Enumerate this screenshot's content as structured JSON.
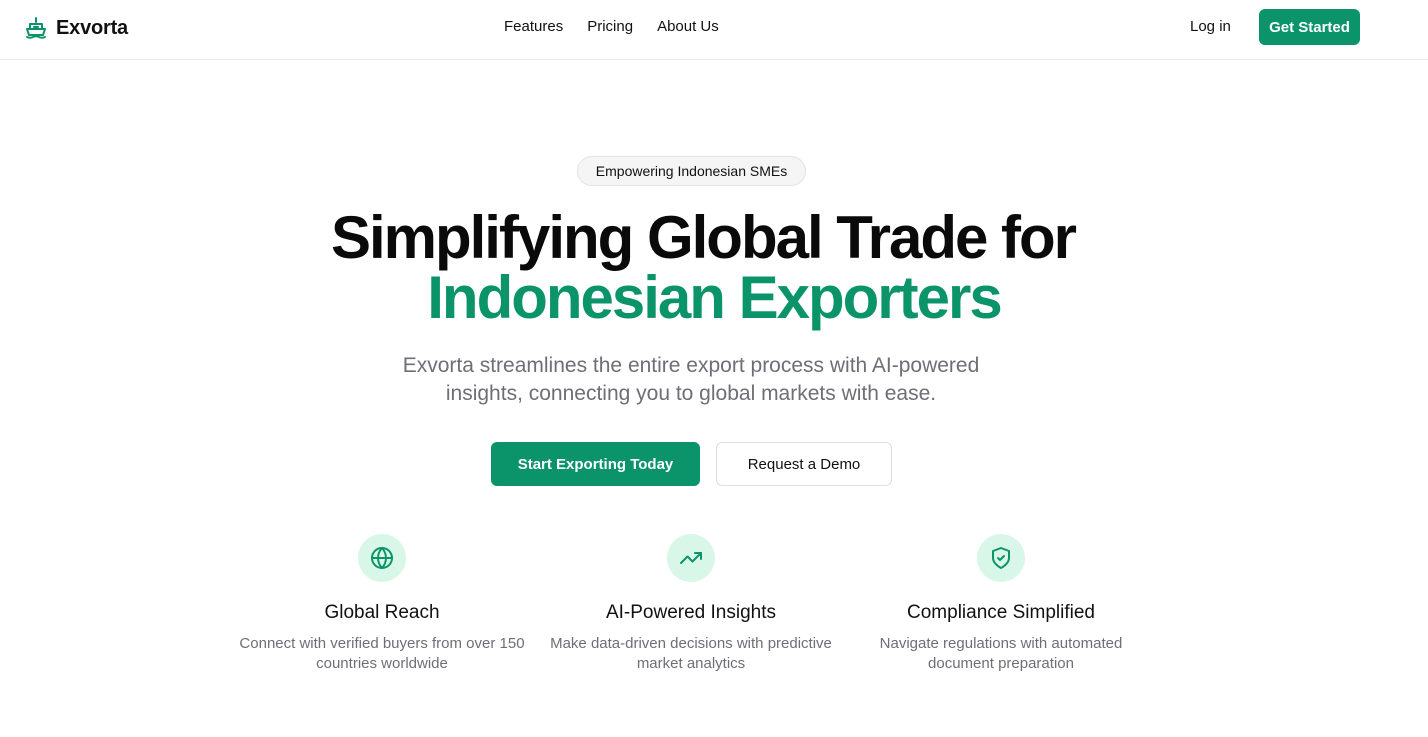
{
  "nav": {
    "brand": "Exvorta",
    "brand_icon": "ship-icon",
    "links": [
      "Features",
      "Pricing",
      "About Us"
    ],
    "login": "Log in",
    "cta": "Get Started"
  },
  "hero": {
    "badge": "Empowering Indonesian SMEs",
    "headline_line1": "Simplifying Global Trade for",
    "headline_line2": "Indonesian Exporters",
    "subtitle": "Exvorta streamlines the entire export process with AI-powered insights, connecting you to global markets with ease.",
    "primary_cta": "Start Exporting Today",
    "secondary_cta": "Request a Demo"
  },
  "features": [
    {
      "icon": "globe-icon",
      "title": "Global Reach",
      "description": "Connect with verified buyers from over 150 countries worldwide"
    },
    {
      "icon": "trending-up-icon",
      "title": "AI-Powered Insights",
      "description": "Make data-driven decisions with predictive market analytics"
    },
    {
      "icon": "shield-check-icon",
      "title": "Compliance Simplified",
      "description": "Navigate regulations with automated document preparation"
    }
  ],
  "colors": {
    "accent": "#0b9469",
    "icon_bg": "#d9f7e8",
    "muted_text": "#6e6e76"
  }
}
